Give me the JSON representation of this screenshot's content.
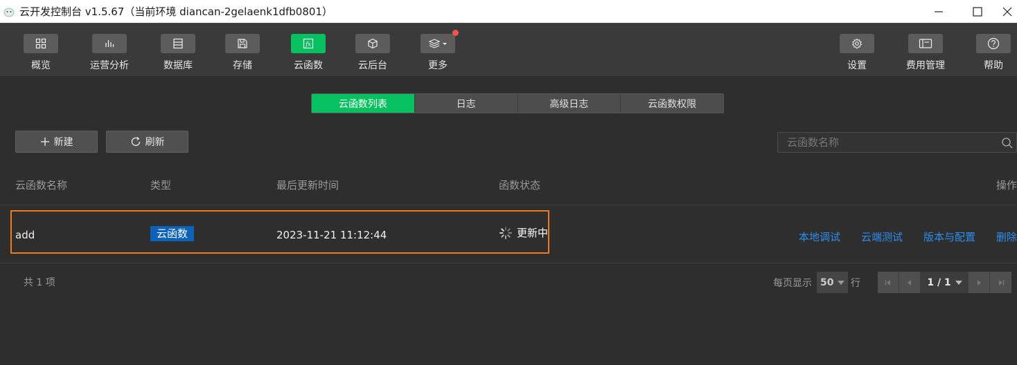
{
  "window": {
    "title": "云开发控制台 v1.5.67（当前环境 diancan-2gelaenk1dfb0801）"
  },
  "toolbar": {
    "left": [
      {
        "label": "概览",
        "icon": "grid-icon"
      },
      {
        "label": "运营分析",
        "icon": "bar-chart-icon"
      },
      {
        "label": "数据库",
        "icon": "database-icon"
      },
      {
        "label": "存储",
        "icon": "floppy-icon"
      },
      {
        "label": "云函数",
        "icon": "function-icon",
        "active": true
      },
      {
        "label": "云后台",
        "icon": "cube-icon"
      },
      {
        "label": "更多",
        "icon": "layers-icon",
        "badge": true
      }
    ],
    "right": [
      {
        "label": "设置",
        "icon": "gear-icon"
      },
      {
        "label": "费用管理",
        "icon": "billing-icon"
      },
      {
        "label": "帮助",
        "icon": "help-icon"
      }
    ]
  },
  "tabs": [
    "云函数列表",
    "日志",
    "高级日志",
    "云函数权限"
  ],
  "actions": {
    "new_label": "新建",
    "refresh_label": "刷新"
  },
  "search": {
    "placeholder": "云函数名称"
  },
  "table": {
    "headers": [
      "云函数名称",
      "类型",
      "最后更新时间",
      "函数状态",
      "操作"
    ],
    "rows": [
      {
        "name": "add",
        "type": "云函数",
        "updated": "2023-11-21 11:12:44",
        "status": "更新中",
        "ops": [
          "本地调试",
          "云端测试",
          "版本与配置",
          "删除"
        ]
      }
    ]
  },
  "footer": {
    "total": "共 1 项",
    "per_page_label": "每页显示",
    "per_page_value": "50",
    "per_page_suffix": "行",
    "page": "1 / 1"
  },
  "colors": {
    "accent": "#07c160",
    "link": "#2c8ef0",
    "tag": "#0b62b6",
    "highlight": "#f07a1e",
    "badge": "#fa5151"
  }
}
